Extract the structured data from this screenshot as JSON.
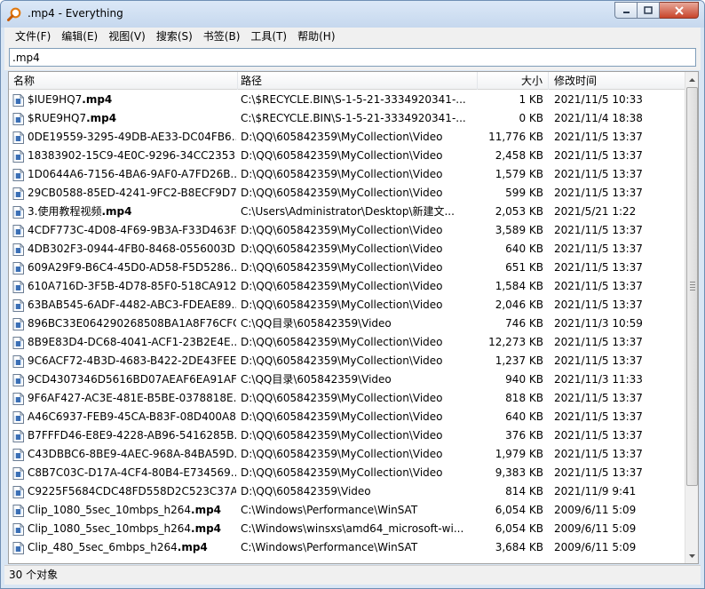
{
  "window": {
    "title": ".mp4 - Everything"
  },
  "menu": [
    "文件(F)",
    "编辑(E)",
    "视图(V)",
    "搜索(S)",
    "书签(B)",
    "工具(T)",
    "帮助(H)"
  ],
  "search": {
    "value": ".mp4"
  },
  "columns": {
    "name": "名称",
    "path": "路径",
    "size": "大小",
    "date": "修改时间"
  },
  "rows": [
    {
      "prefix": "$IUE9HQ7",
      "ext": ".mp4",
      "path": "C:\\$RECYCLE.BIN\\S-1-5-21-3334920341-...",
      "size": "1 KB",
      "date": "2021/11/5 10:33"
    },
    {
      "prefix": "$RUE9HQ7",
      "ext": ".mp4",
      "path": "C:\\$RECYCLE.BIN\\S-1-5-21-3334920341-...",
      "size": "0 KB",
      "date": "2021/11/4 18:38"
    },
    {
      "prefix": "0DE19559-3295-49DB-AE33-DC04FB6...",
      "ext": "",
      "path": "D:\\QQ\\605842359\\MyCollection\\Video",
      "size": "11,776 KB",
      "date": "2021/11/5 13:37"
    },
    {
      "prefix": "18383902-15C9-4E0C-9296-34CC2353...",
      "ext": "",
      "path": "D:\\QQ\\605842359\\MyCollection\\Video",
      "size": "2,458 KB",
      "date": "2021/11/5 13:37"
    },
    {
      "prefix": "1D0644A6-7156-4BA6-9AF0-A7FD26B...",
      "ext": "",
      "path": "D:\\QQ\\605842359\\MyCollection\\Video",
      "size": "1,579 KB",
      "date": "2021/11/5 13:37"
    },
    {
      "prefix": "29CB0588-85ED-4241-9FC2-B8ECF9D7...",
      "ext": "",
      "path": "D:\\QQ\\605842359\\MyCollection\\Video",
      "size": "599 KB",
      "date": "2021/11/5 13:37"
    },
    {
      "prefix": "3.使用教程视频",
      "ext": ".mp4",
      "path": "C:\\Users\\Administrator\\Desktop\\新建文...",
      "size": "2,053 KB",
      "date": "2021/5/21 1:22"
    },
    {
      "prefix": "4CDF773C-4D08-4F69-9B3A-F33D463F...",
      "ext": "",
      "path": "D:\\QQ\\605842359\\MyCollection\\Video",
      "size": "3,589 KB",
      "date": "2021/11/5 13:37"
    },
    {
      "prefix": "4DB302F3-0944-4FB0-8468-0556003D...",
      "ext": "",
      "path": "D:\\QQ\\605842359\\MyCollection\\Video",
      "size": "640 KB",
      "date": "2021/11/5 13:37"
    },
    {
      "prefix": "609A29F9-B6C4-45D0-AD58-F5D5286...",
      "ext": "",
      "path": "D:\\QQ\\605842359\\MyCollection\\Video",
      "size": "651 KB",
      "date": "2021/11/5 13:37"
    },
    {
      "prefix": "610A716D-3F5B-4D78-85F0-518CA912...",
      "ext": "",
      "path": "D:\\QQ\\605842359\\MyCollection\\Video",
      "size": "1,584 KB",
      "date": "2021/11/5 13:37"
    },
    {
      "prefix": "63BAB545-6ADF-4482-ABC3-FDEAE89...",
      "ext": "",
      "path": "D:\\QQ\\605842359\\MyCollection\\Video",
      "size": "2,046 KB",
      "date": "2021/11/5 13:37"
    },
    {
      "prefix": "896BC33E064290268508BA1A8F76CFC...",
      "ext": "",
      "path": "C:\\QQ目录\\605842359\\Video",
      "size": "746 KB",
      "date": "2021/11/3 10:59"
    },
    {
      "prefix": "8B9E83D4-DC68-4041-ACF1-23B2E4E...",
      "ext": "",
      "path": "D:\\QQ\\605842359\\MyCollection\\Video",
      "size": "12,273 KB",
      "date": "2021/11/5 13:37"
    },
    {
      "prefix": "9C6ACF72-4B3D-4683-B422-2DE43FEE...",
      "ext": "",
      "path": "D:\\QQ\\605842359\\MyCollection\\Video",
      "size": "1,237 KB",
      "date": "2021/11/5 13:37"
    },
    {
      "prefix": "9CD4307346D5616BD07AEAF6EA91AF...",
      "ext": "",
      "path": "C:\\QQ目录\\605842359\\Video",
      "size": "940 KB",
      "date": "2021/11/3 11:33"
    },
    {
      "prefix": "9F6AF427-AC3E-481E-B5BE-0378818E...",
      "ext": "",
      "path": "D:\\QQ\\605842359\\MyCollection\\Video",
      "size": "818 KB",
      "date": "2021/11/5 13:37"
    },
    {
      "prefix": "A46C6937-FEB9-45CA-B83F-08D400A8...",
      "ext": "",
      "path": "D:\\QQ\\605842359\\MyCollection\\Video",
      "size": "640 KB",
      "date": "2021/11/5 13:37"
    },
    {
      "prefix": "B7FFFD46-E8E9-4228-AB96-5416285B...",
      "ext": "",
      "path": "D:\\QQ\\605842359\\MyCollection\\Video",
      "size": "376 KB",
      "date": "2021/11/5 13:37"
    },
    {
      "prefix": "C43DBBC6-8BE9-4AEC-968A-84BA59D...",
      "ext": "",
      "path": "D:\\QQ\\605842359\\MyCollection\\Video",
      "size": "1,979 KB",
      "date": "2021/11/5 13:37"
    },
    {
      "prefix": "C8B7C03C-D17A-4CF4-80B4-E734569...",
      "ext": "",
      "path": "D:\\QQ\\605842359\\MyCollection\\Video",
      "size": "9,383 KB",
      "date": "2021/11/5 13:37"
    },
    {
      "prefix": "C9225F5684CDC48FD558D2C523C37A...",
      "ext": "",
      "path": "D:\\QQ\\605842359\\Video",
      "size": "814 KB",
      "date": "2021/11/9 9:41"
    },
    {
      "prefix": "Clip_1080_5sec_10mbps_h264",
      "ext": ".mp4",
      "path": "C:\\Windows\\Performance\\WinSAT",
      "size": "6,054 KB",
      "date": "2009/6/11 5:09"
    },
    {
      "prefix": "Clip_1080_5sec_10mbps_h264",
      "ext": ".mp4",
      "path": "C:\\Windows\\winsxs\\amd64_microsoft-wi...",
      "size": "6,054 KB",
      "date": "2009/6/11 5:09"
    },
    {
      "prefix": "Clip_480_5sec_6mbps_h264",
      "ext": ".mp4",
      "path": "C:\\Windows\\Performance\\WinSAT",
      "size": "3,684 KB",
      "date": "2009/6/11 5:09"
    }
  ],
  "status": {
    "text": "30 个对象"
  }
}
